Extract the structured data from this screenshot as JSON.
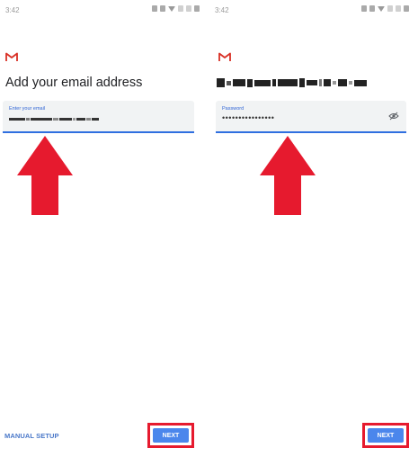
{
  "status_bar": {
    "time": "3:42"
  },
  "colors": {
    "accent": "#2f6fe0",
    "highlight": "#e61a2e",
    "button": "#4b86ec",
    "gmail_red": "#d93025"
  },
  "left_screen": {
    "heading": "Add your email address",
    "field_label": "Enter your email",
    "manual_setup_label": "MANUAL SETUP",
    "next_label": "NEXT"
  },
  "right_screen": {
    "field_label": "Password",
    "password_mask": "••••••••••••••••",
    "next_label": "NEXT"
  },
  "icons": {
    "logo": "gmail-logo-icon",
    "visibility": "eye-off-icon",
    "annotation": "red-up-arrow"
  }
}
